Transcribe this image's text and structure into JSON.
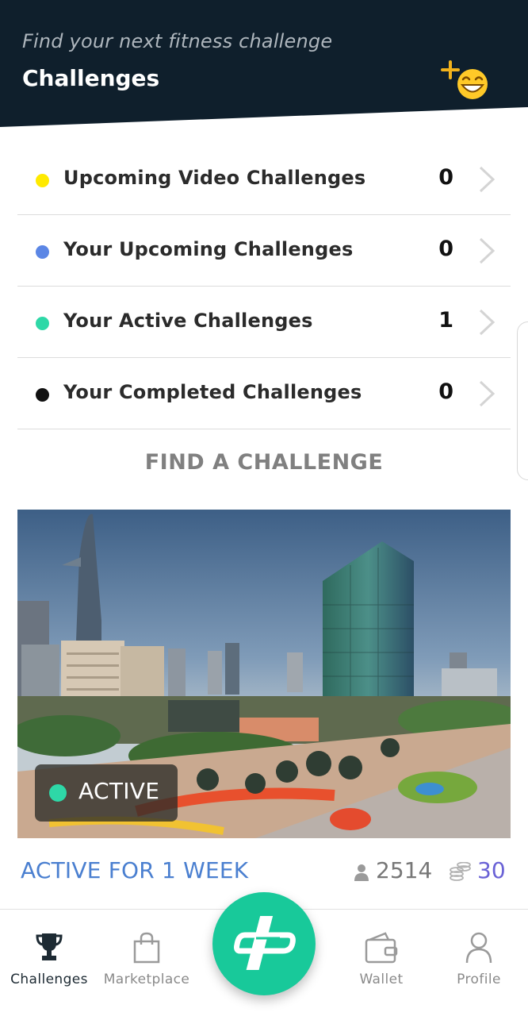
{
  "header": {
    "subtitle": "Find your next fitness challenge",
    "title": "Challenges",
    "background": "#0f1f2c",
    "action_icon": "add-friend-emoji-icon"
  },
  "challenge_list": [
    {
      "label": "Upcoming Video Challenges",
      "count": "0",
      "dot_color": "#ffea00"
    },
    {
      "label": "Your Upcoming Challenges",
      "count": "0",
      "dot_color": "#5b86e5"
    },
    {
      "label": "Your Active Challenges",
      "count": "1",
      "dot_color": "#2ed8a7"
    },
    {
      "label": "Your Completed Challenges",
      "count": "0",
      "dot_color": "#111111"
    }
  ],
  "find_label": "FIND A CHALLENGE",
  "featured": {
    "status": "ACTIVE",
    "status_color": "#2ed8a7",
    "duration_label": "ACTIVE FOR 1 WEEK",
    "participants": "2514",
    "coins": "30"
  },
  "bottom_nav": [
    {
      "label": "Challenges",
      "icon": "trophy-icon",
      "active": true
    },
    {
      "label": "Marketplace",
      "icon": "shopping-bag-icon",
      "active": false
    },
    {
      "label": "Wallet",
      "icon": "wallet-icon",
      "active": false
    },
    {
      "label": "Profile",
      "icon": "profile-icon",
      "active": false
    }
  ],
  "fab_icon": "app-logo-icon",
  "accent": "#18c99a"
}
